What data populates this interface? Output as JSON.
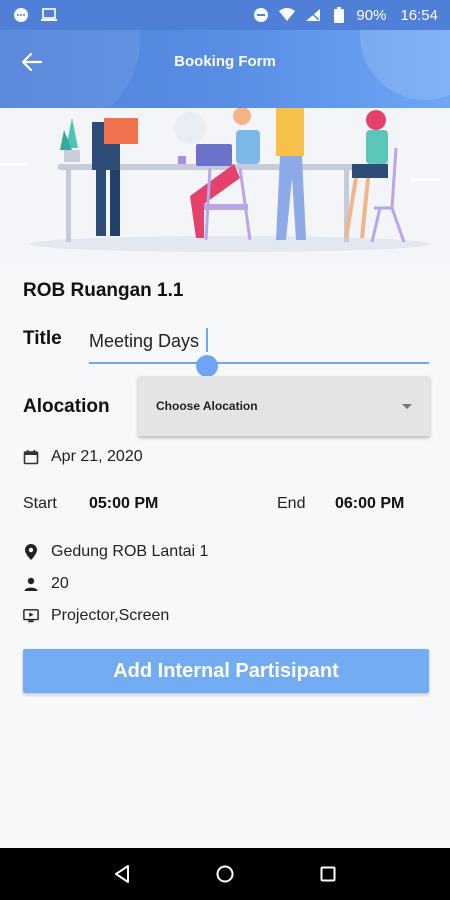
{
  "status_bar": {
    "battery": "90%",
    "time": "16:54"
  },
  "app_bar": {
    "title": "Booking Form"
  },
  "room": {
    "name": "ROB Ruangan 1.1"
  },
  "form": {
    "title_label": "Title",
    "title_value": "Meeting Days",
    "allocation_label": "Alocation",
    "allocation_placeholder": "Choose Alocation",
    "date": "Apr 21, 2020",
    "start_label": "Start",
    "start_time": "05:00 PM",
    "end_label": "End",
    "end_time": "06:00 PM"
  },
  "room_info": {
    "location": "Gedung ROB Lantai 1",
    "capacity": "20",
    "facilities": "Projector,Screen"
  },
  "actions": {
    "add_participant": "Add Internal Partisipant"
  },
  "colors": {
    "primary": "#4f80d8",
    "accent": "#74acf3"
  }
}
